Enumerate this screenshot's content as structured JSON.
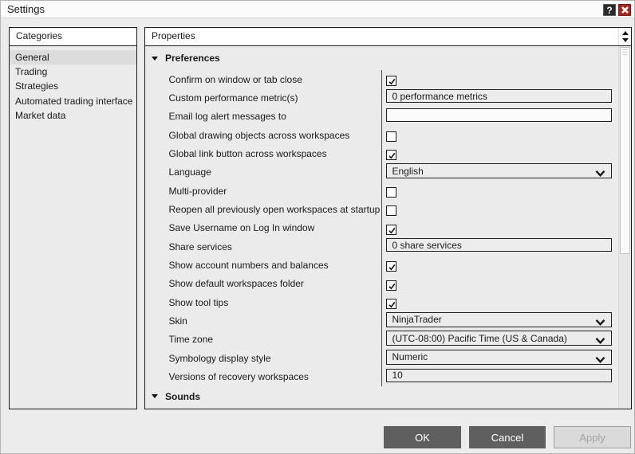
{
  "window": {
    "title": "Settings"
  },
  "titlebar": {
    "help_glyph": "?"
  },
  "categories": {
    "header": "Categories",
    "items": [
      {
        "label": "General",
        "selected": true
      },
      {
        "label": "Trading",
        "selected": false
      },
      {
        "label": "Strategies",
        "selected": false
      },
      {
        "label": "Automated trading interface",
        "selected": false
      },
      {
        "label": "Market data",
        "selected": false
      }
    ]
  },
  "properties": {
    "header": "Properties",
    "groups": [
      {
        "label": "Preferences",
        "expanded": true,
        "rows": [
          {
            "name": "confirm-on-window-or-tab-close",
            "label": "Confirm on window or tab close",
            "type": "checkbox",
            "checked": true
          },
          {
            "name": "custom-performance-metrics",
            "label": "Custom performance metric(s)",
            "type": "field",
            "value": "0 performance metrics",
            "white": false
          },
          {
            "name": "email-log-alert-messages-to",
            "label": "Email log alert messages to",
            "type": "field",
            "value": "",
            "white": true
          },
          {
            "name": "global-drawing-objects-across-workspaces",
            "label": "Global drawing objects across workspaces",
            "type": "checkbox",
            "checked": false
          },
          {
            "name": "global-link-button-across-workspaces",
            "label": "Global link button across workspaces",
            "type": "checkbox",
            "checked": true
          },
          {
            "name": "language",
            "label": "Language",
            "type": "dropdown",
            "value": "English"
          },
          {
            "name": "multi-provider",
            "label": "Multi-provider",
            "type": "checkbox",
            "checked": false
          },
          {
            "name": "reopen-all-previously-open-workspaces-at-startup",
            "label": "Reopen all previously open workspaces at startup",
            "type": "checkbox",
            "checked": false
          },
          {
            "name": "save-username-on-log-in-window",
            "label": "Save Username on Log In window",
            "type": "checkbox",
            "checked": true
          },
          {
            "name": "share-services",
            "label": "Share services",
            "type": "field",
            "value": "0 share services",
            "white": false
          },
          {
            "name": "show-account-numbers-and-balances",
            "label": "Show account numbers and balances",
            "type": "checkbox",
            "checked": true
          },
          {
            "name": "show-default-workspaces-folder",
            "label": "Show default workspaces folder",
            "type": "checkbox",
            "checked": true
          },
          {
            "name": "show-tool-tips",
            "label": "Show tool tips",
            "type": "checkbox",
            "checked": true
          },
          {
            "name": "skin",
            "label": "Skin",
            "type": "dropdown",
            "value": "NinjaTrader"
          },
          {
            "name": "time-zone",
            "label": "Time zone",
            "type": "dropdown",
            "value": "(UTC-08:00) Pacific Time (US & Canada)"
          },
          {
            "name": "symbology-display-style",
            "label": "Symbology display style",
            "type": "dropdown",
            "value": "Numeric"
          },
          {
            "name": "versions-of-recovery-workspaces",
            "label": "Versions of recovery workspaces",
            "type": "field",
            "value": "10",
            "white": false
          }
        ]
      },
      {
        "label": "Sounds",
        "expanded": true
      }
    ]
  },
  "footer": {
    "ok_label": "OK",
    "cancel_label": "Cancel",
    "apply_label": "Apply"
  }
}
